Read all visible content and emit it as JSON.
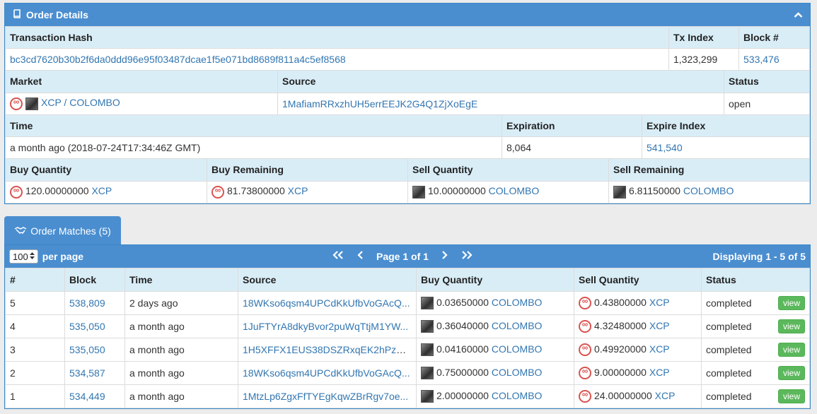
{
  "details": {
    "title": "Order Details",
    "row1_headers": {
      "hash": "Transaction Hash",
      "tx_index": "Tx Index",
      "block": "Block #"
    },
    "hash": "bc3cd7620b30b2f6da0ddd96e95f03487dcae1f5e071bd8689f811a4c5ef8568",
    "tx_index": "1,323,299",
    "block": "533,476",
    "row2_headers": {
      "market": "Market",
      "source": "Source",
      "status": "Status"
    },
    "market": "XCP / COLOMBO",
    "source": "1MafiamRRxzhUH5errEEJK2G4Q1ZjXoEgE",
    "status": "open",
    "row3_headers": {
      "time": "Time",
      "expiration": "Expiration",
      "expire_index": "Expire Index"
    },
    "time": "a month ago (2018-07-24T17:34:46Z GMT)",
    "expiration": "8,064",
    "expire_index": "541,540",
    "row4_headers": {
      "buy_qty": "Buy Quantity",
      "buy_rem": "Buy Remaining",
      "sell_qty": "Sell Quantity",
      "sell_rem": "Sell Remaining"
    },
    "buy_qty": {
      "amount": "120.00000000",
      "asset": "XCP"
    },
    "buy_rem": {
      "amount": "81.73800000",
      "asset": "XCP"
    },
    "sell_qty": {
      "amount": "10.00000000",
      "asset": "COLOMBO"
    },
    "sell_rem": {
      "amount": "6.81150000",
      "asset": "COLOMBO"
    }
  },
  "matches": {
    "tab_label": "Order Matches (5)",
    "per_page_value": "100",
    "per_page_label": "per page",
    "page_label": "Page 1 of 1",
    "displaying": "Displaying 1 - 5 of 5",
    "headers": {
      "num": "#",
      "block": "Block",
      "time": "Time",
      "source": "Source",
      "buy": "Buy Quantity",
      "sell": "Sell Quantity",
      "status": "Status"
    },
    "view_label": "view",
    "rows": [
      {
        "num": "5",
        "block": "538,809",
        "time": "2 days ago",
        "source": "18WKso6qsm4UPCdKkUfbVoGAcQ...",
        "buy_amount": "0.03650000",
        "buy_asset": "COLOMBO",
        "sell_amount": "0.43800000",
        "sell_asset": "XCP",
        "status": "completed"
      },
      {
        "num": "4",
        "block": "535,050",
        "time": "a month ago",
        "source": "1JuFTYrA8dkyBvor2puWqTtjM1YW...",
        "buy_amount": "0.36040000",
        "buy_asset": "COLOMBO",
        "sell_amount": "4.32480000",
        "sell_asset": "XCP",
        "status": "completed"
      },
      {
        "num": "3",
        "block": "535,050",
        "time": "a month ago",
        "source": "1H5XFFX1EUS38DSZRxqEK2hPzM...",
        "buy_amount": "0.04160000",
        "buy_asset": "COLOMBO",
        "sell_amount": "0.49920000",
        "sell_asset": "XCP",
        "status": "completed"
      },
      {
        "num": "2",
        "block": "534,587",
        "time": "a month ago",
        "source": "18WKso6qsm4UPCdKkUfbVoGAcQ...",
        "buy_amount": "0.75000000",
        "buy_asset": "COLOMBO",
        "sell_amount": "9.00000000",
        "sell_asset": "XCP",
        "status": "completed"
      },
      {
        "num": "1",
        "block": "534,449",
        "time": "a month ago",
        "source": "1MtzLp6ZgxFfTYEgKqwZBrRgv7oe...",
        "buy_amount": "2.00000000",
        "buy_asset": "COLOMBO",
        "sell_amount": "24.00000000",
        "sell_asset": "XCP",
        "status": "completed"
      }
    ]
  },
  "icons": {
    "book": "book-icon",
    "chevron": "chevron-up-icon",
    "handshake": "handshake-icon",
    "xcp": "xcp-token-icon",
    "colombo": "colombo-token-icon"
  }
}
